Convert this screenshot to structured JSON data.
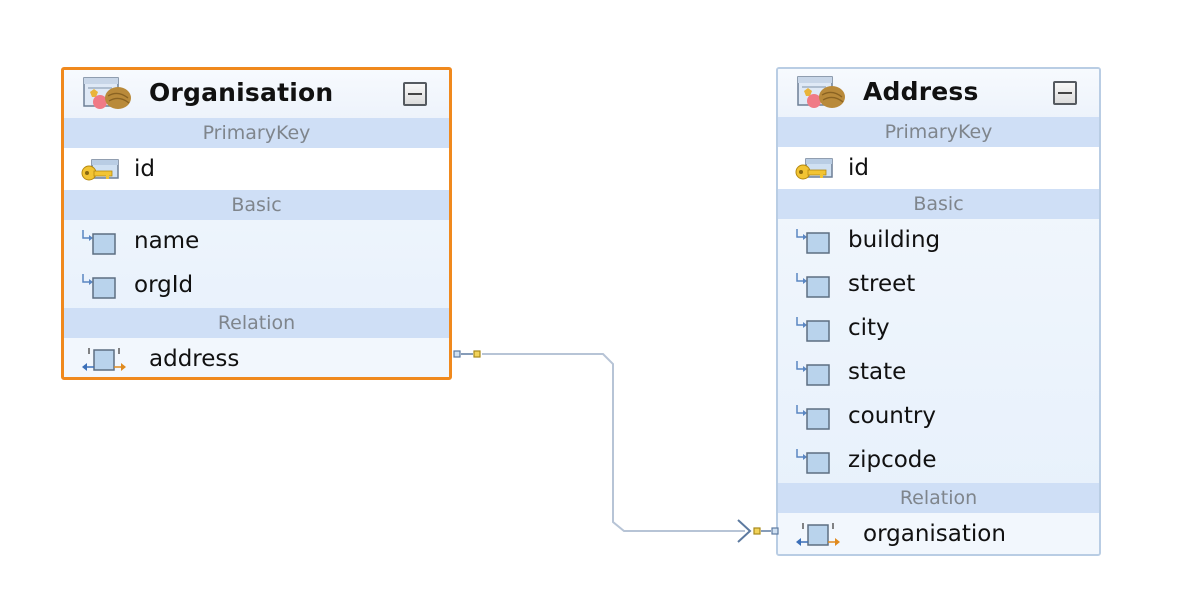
{
  "entities": [
    {
      "name": "Organisation",
      "selected": true,
      "sections": {
        "primary_key": {
          "label": "PrimaryKey",
          "fields": [
            "id"
          ]
        },
        "basic": {
          "label": "Basic",
          "fields": [
            "name",
            "orgId"
          ]
        },
        "relation": {
          "label": "Relation",
          "fields": [
            "address"
          ]
        }
      }
    },
    {
      "name": "Address",
      "selected": false,
      "sections": {
        "primary_key": {
          "label": "PrimaryKey",
          "fields": [
            "id"
          ]
        },
        "basic": {
          "label": "Basic",
          "fields": [
            "building",
            "street",
            "city",
            "state",
            "country",
            "zipcode"
          ]
        },
        "relation": {
          "label": "Relation",
          "fields": [
            "organisation"
          ]
        }
      }
    }
  ],
  "relationships": [
    {
      "from": "Organisation.address",
      "to": "Address.organisation",
      "target_end": "many (crow's foot)"
    }
  ],
  "icons": {
    "entity": "entity-icon",
    "primary_key": "key-icon",
    "basic": "attribute-icon",
    "relation": "relation-icon",
    "collapse": "collapse-icon"
  },
  "colors": {
    "selected_border": "#f0891d",
    "entity_border": "#b9cde4",
    "section_header_bg": "#cfdff6",
    "section_header_text": "#7f858c",
    "connector": "#b7c4d6"
  }
}
